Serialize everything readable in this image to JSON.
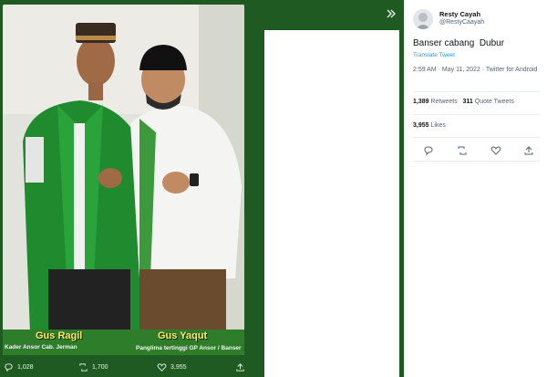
{
  "viewer": {
    "caption_left_name": "Gus Ragil",
    "caption_left_sub": "Kader Ansor Cab. Jerman",
    "caption_right_name": "Gus Yaqut",
    "caption_right_sub": "Panglima tertinggi GP Ansor / Banser",
    "actions": {
      "reply_count": "1,028",
      "retweet_count": "1,700",
      "like_count": "3,955"
    },
    "expand_icon": "chevrons-right-icon",
    "bg_color": "#1f5a22"
  },
  "tweet": {
    "display_name": "Resty Cayah",
    "handle": "@RestyCaayah",
    "text": "Banser cabang  Dubur",
    "translate_label": "Translate Tweet",
    "meta": "2:59 AM · May 11, 2022 · Twitter for Android",
    "retweets_count": "1,389",
    "retweets_label": "Retweets",
    "quotes_count": "311",
    "quotes_label": "Quote Tweets",
    "likes_count": "3,955",
    "likes_label": "Likes",
    "accent_color": "#1d9bf0"
  }
}
